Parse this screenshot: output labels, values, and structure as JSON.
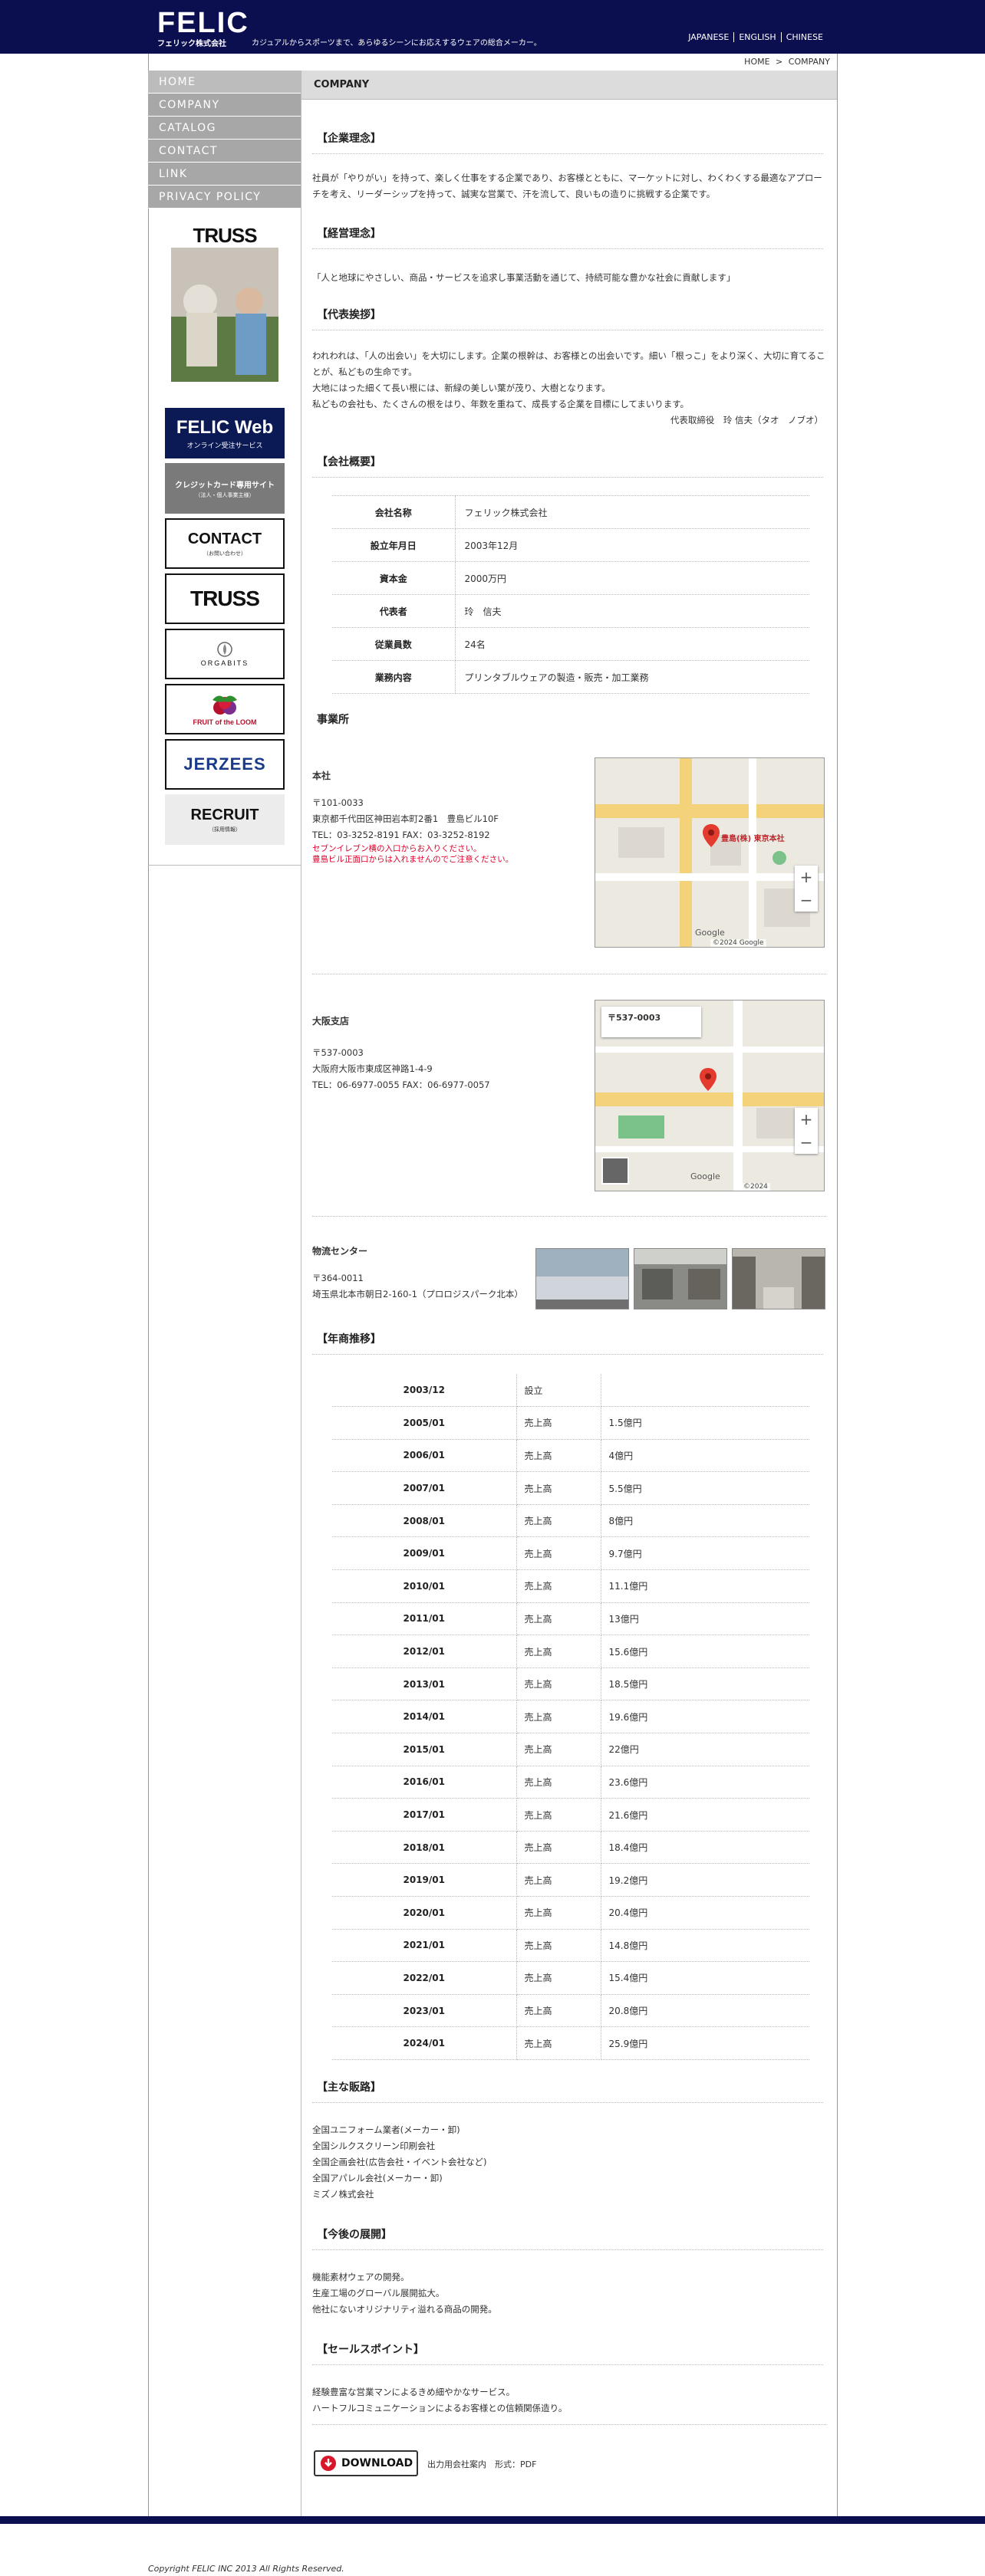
{
  "header": {
    "logo": "FELIC",
    "logo_sub": "フェリック株式会社",
    "tagline": "カジュアルからスポーツまで、あらゆるシーンにお応えするウェアの総合メーカー。",
    "languages": [
      "JAPANESE",
      "ENGLISH",
      "CHINESE"
    ]
  },
  "breadcrumb": {
    "home": "HOME",
    "sep": ">",
    "current": "COMPANY"
  },
  "nav": [
    "HOME",
    "COMPANY",
    "CATALOG",
    "CONTACT",
    "LINK",
    "PRIVACY POLICY"
  ],
  "banners": {
    "truss_photo": "TRUSS",
    "felic_web": "FELIC Web",
    "felic_web_sub": "オンライン受注サービス",
    "credit": "クレジットカード専用サイト",
    "credit_sub": "（法人・個人事業主様）",
    "contact": "CONTACT",
    "contact_sub": "（お問い合わせ）",
    "truss": "TRUSS",
    "orgabits": "ORGABITS",
    "fruit": "FRUIT of the LOOM",
    "jerzees": "JERZEES",
    "recruit": "RECRUIT",
    "recruit_sub": "（採用情報）"
  },
  "page_title": "COMPANY",
  "sections": {
    "philosophy": {
      "title": "【企業理念】",
      "text": "社員が「やりがい」を持って、楽しく仕事をする企業であり、お客様とともに、マーケットに対し、わくわくする最適なアプローチを考え、リーダーシップを持って、誠実な営業で、汗を流して、良いもの造りに挑戦する企業です。"
    },
    "management": {
      "title": "【経営理念】",
      "text": "「人と地球にやさしい、商品・サービスを追求し事業活動を通じて、持続可能な豊かな社会に貢献します」"
    },
    "greeting": {
      "title": "【代表挨拶】",
      "lines": [
        "われわれは、「人の出会い」を大切にします。企業の根幹は、お客様との出会いです。細い「根っこ」をより深く、大切に育てることが、私どもの生命です。",
        "大地にはった細くて長い根には、新緑の美しい葉が茂り、大樹となります。",
        "私どもの会社も、たくさんの根をはり、年数を重ねて、成長する企業を目標にしてまいります。"
      ],
      "signature": "代表取締役　玲 信夫（タオ　ノブオ）"
    },
    "overview": {
      "title": "【会社概要】",
      "rows": [
        {
          "k": "会社名称",
          "v": "フェリック株式会社"
        },
        {
          "k": "設立年月日",
          "v": "2003年12月"
        },
        {
          "k": "資本金",
          "v": "2000万円"
        },
        {
          "k": "代表者",
          "v": "玲　信夫"
        },
        {
          "k": "従業員数",
          "v": "24名"
        },
        {
          "k": "業務内容",
          "v": "プリンタブルウェアの製造・販売・加工業務"
        }
      ]
    },
    "offices": {
      "title": "事業所",
      "head": {
        "name": "本社",
        "zip": "〒101-0033",
        "address": "東京都千代田区神田岩本町2番1　豊島ビル10F",
        "tel": "TEL：03-3252-8191 FAX：03-3252-8192",
        "note1": "セブンイレブン横の入口からお入りください。",
        "note2": "豊島ビル正面口からは入れませんのでご注意ください。",
        "map_label": "豊島(株) 東京本社",
        "map_credit": "Google",
        "map_copy": "©2024 Google"
      },
      "osaka": {
        "name": "大阪支店",
        "zip": "〒537-0003",
        "address": "大阪府大阪市東成区神路1-4-9",
        "tel": "TEL：06-6977-0055 FAX：06-6977-0057",
        "map_label": "〒537-0003",
        "map_credit": "Google",
        "map_copy": "©2024"
      },
      "logistics": {
        "name": "物流センター",
        "zip": "〒364-0011",
        "address": "埼玉県北本市朝日2-160-1（プロロジスパーク北本）"
      }
    },
    "history": {
      "title": "【年商推移】",
      "rows": [
        {
          "y": "2003/12",
          "l": "設立",
          "a": ""
        },
        {
          "y": "2005/01",
          "l": "売上高",
          "a": "1.5億円"
        },
        {
          "y": "2006/01",
          "l": "売上高",
          "a": "4億円"
        },
        {
          "y": "2007/01",
          "l": "売上高",
          "a": "5.5億円"
        },
        {
          "y": "2008/01",
          "l": "売上高",
          "a": "8億円"
        },
        {
          "y": "2009/01",
          "l": "売上高",
          "a": "9.7億円"
        },
        {
          "y": "2010/01",
          "l": "売上高",
          "a": "11.1億円"
        },
        {
          "y": "2011/01",
          "l": "売上高",
          "a": "13億円"
        },
        {
          "y": "2012/01",
          "l": "売上高",
          "a": "15.6億円"
        },
        {
          "y": "2013/01",
          "l": "売上高",
          "a": "18.5億円"
        },
        {
          "y": "2014/01",
          "l": "売上高",
          "a": "19.6億円"
        },
        {
          "y": "2015/01",
          "l": "売上高",
          "a": "22億円"
        },
        {
          "y": "2016/01",
          "l": "売上高",
          "a": "23.6億円"
        },
        {
          "y": "2017/01",
          "l": "売上高",
          "a": "21.6億円"
        },
        {
          "y": "2018/01",
          "l": "売上高",
          "a": "18.4億円"
        },
        {
          "y": "2019/01",
          "l": "売上高",
          "a": "19.2億円"
        },
        {
          "y": "2020/01",
          "l": "売上高",
          "a": "20.4億円"
        },
        {
          "y": "2021/01",
          "l": "売上高",
          "a": "14.8億円"
        },
        {
          "y": "2022/01",
          "l": "売上高",
          "a": "15.4億円"
        },
        {
          "y": "2023/01",
          "l": "売上高",
          "a": "20.8億円"
        },
        {
          "y": "2024/01",
          "l": "売上高",
          "a": "25.9億円"
        }
      ]
    },
    "clients": {
      "title": "【主な販路】",
      "lines": [
        "全国ユニフォーム業者(メーカー・卸)",
        "全国シルクスクリーン印刷会社",
        "全国企画会社(広告会社・イベント会社など)",
        "全国アパレル会社(メーカー・卸)",
        "ミズノ株式会社"
      ]
    },
    "future": {
      "title": "【今後の展開】",
      "lines": [
        "機能素材ウェアの開発。",
        "生産工場のグローバル展開拡大。",
        "他社にないオリジナリティ溢れる商品の開発。"
      ]
    },
    "selling": {
      "title": "【セールスポイント】",
      "lines": [
        "経験豊富な営業マンによるきめ細やかなサービス。",
        "ハートフルコミュニケーションによるお客様との信頼関係造り。"
      ]
    },
    "download": {
      "button": "DOWNLOAD",
      "caption": "出力用会社案内　形式：PDF"
    }
  },
  "footer": {
    "copyright": "Copyright FELIC INC 2013 All Rights Reserved."
  },
  "colors": {
    "navy": "#0b0f4f",
    "nav_gray": "#a7a7a7",
    "note_red": "#e0002a"
  }
}
